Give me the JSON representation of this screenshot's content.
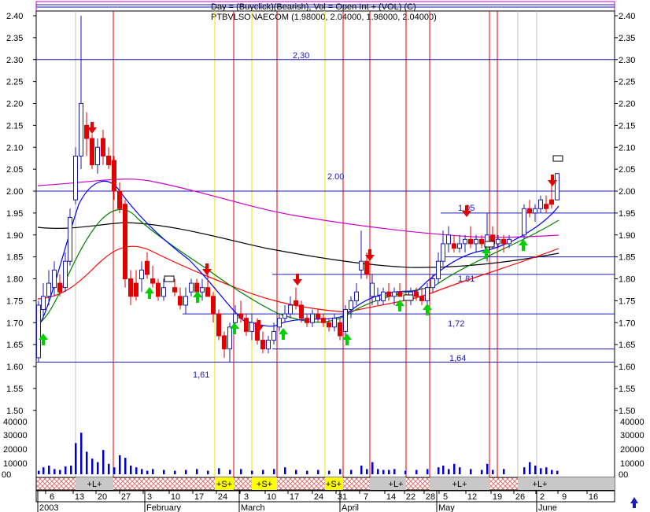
{
  "header": {
    "line1": "Day = (Buyclick)(Bearish), Vol = Open Int + (VOL) (C)",
    "line2": "PTBVLSONAECOM (1.98000, 2.04000, 1.98000, 2.04000)"
  },
  "chart_data": {
    "type": "candlestick",
    "ylim": [
      1.58,
      2.48
    ],
    "y_ticks": [
      "2.45",
      "2.40",
      "2.35",
      "2.30",
      "2.25",
      "2.20",
      "2.15",
      "2.10",
      "2.05",
      "2.00",
      "1.95",
      "1.90",
      "1.85",
      "1.80",
      "1.75",
      "1.70",
      "1.65",
      "1.60",
      "1.55",
      "1.50"
    ],
    "volume_ticks": [
      "40000",
      "30000",
      "20000",
      "10000",
      "00"
    ],
    "x_day_ticks": [
      "6",
      "13",
      "20",
      "27",
      "3",
      "10",
      "17",
      "24",
      "3",
      "10",
      "17",
      "24",
      "31",
      "7",
      "14",
      "22",
      "28",
      "5",
      "12",
      "19",
      "26",
      "2",
      "9",
      "16"
    ],
    "x_month_labels": [
      "2003",
      "February",
      "March",
      "April",
      "May",
      "June"
    ],
    "h_levels": [
      {
        "value": 2.3,
        "label": "2,30"
      },
      {
        "value": 2.0,
        "label": "2.00"
      },
      {
        "value": 1.95,
        "label": "1.95"
      },
      {
        "value": 1.85,
        "label": ""
      },
      {
        "value": 1.81,
        "label": "1.81"
      },
      {
        "value": 1.72,
        "label": "1,72"
      },
      {
        "value": 1.64,
        "label": "1,64"
      },
      {
        "value": 1.61,
        "label": "1,61"
      }
    ],
    "band_labels": [
      "+L+",
      "+S+",
      "+S+",
      "+S+",
      "+L+",
      "+L+",
      "+L+"
    ],
    "up_arrows": 13,
    "down_arrows": 8,
    "colors": {
      "up_candle": "#1a1ab4",
      "down_candle": "#e00000",
      "ma_fast": "#0000ff",
      "ma_mid": "#008000",
      "ma_slow": "#ff0000",
      "ma_200": "#000000",
      "ma_magenta": "#cc00cc"
    }
  }
}
